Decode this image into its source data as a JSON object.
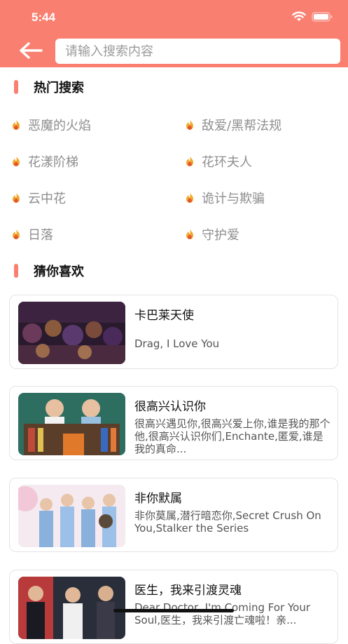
{
  "status_bar": {
    "time": "5:44",
    "icons": [
      "wifi-icon",
      "battery-icon"
    ]
  },
  "search": {
    "placeholder": "请输入搜索内容",
    "back_icon": "arrow-left-icon"
  },
  "hot_search": {
    "title": "热门搜索",
    "icon": "fire-icon",
    "items": [
      "恶魔的火焰",
      "敌爱/黑帮法规",
      "花漾阶梯",
      "花环夫人",
      "云中花",
      "诡计与欺骗",
      "日落",
      "守护爱"
    ]
  },
  "recommend": {
    "title": "猜你喜欢",
    "cards": [
      {
        "title": "卡巴莱天使",
        "desc": "Drag, I Love You"
      },
      {
        "title": "很高兴认识你",
        "desc": "很高兴遇见你,很高兴爱上你,谁是我的那个他,很高兴认识你们,Enchante,匿爱,谁是我的真命..."
      },
      {
        "title": "非你默属",
        "desc": "非你莫属,潜行暗恋你,Secret Crush On You,Stalker the Series"
      },
      {
        "title": "医生，我来引渡灵魂",
        "desc": "Dear Doctor, I'm Coming For Your Soul,医生，我来引渡亡魂啦！亲..."
      }
    ]
  },
  "colors": {
    "accent": "#f98071",
    "hot_text": "#8e8e8e"
  }
}
